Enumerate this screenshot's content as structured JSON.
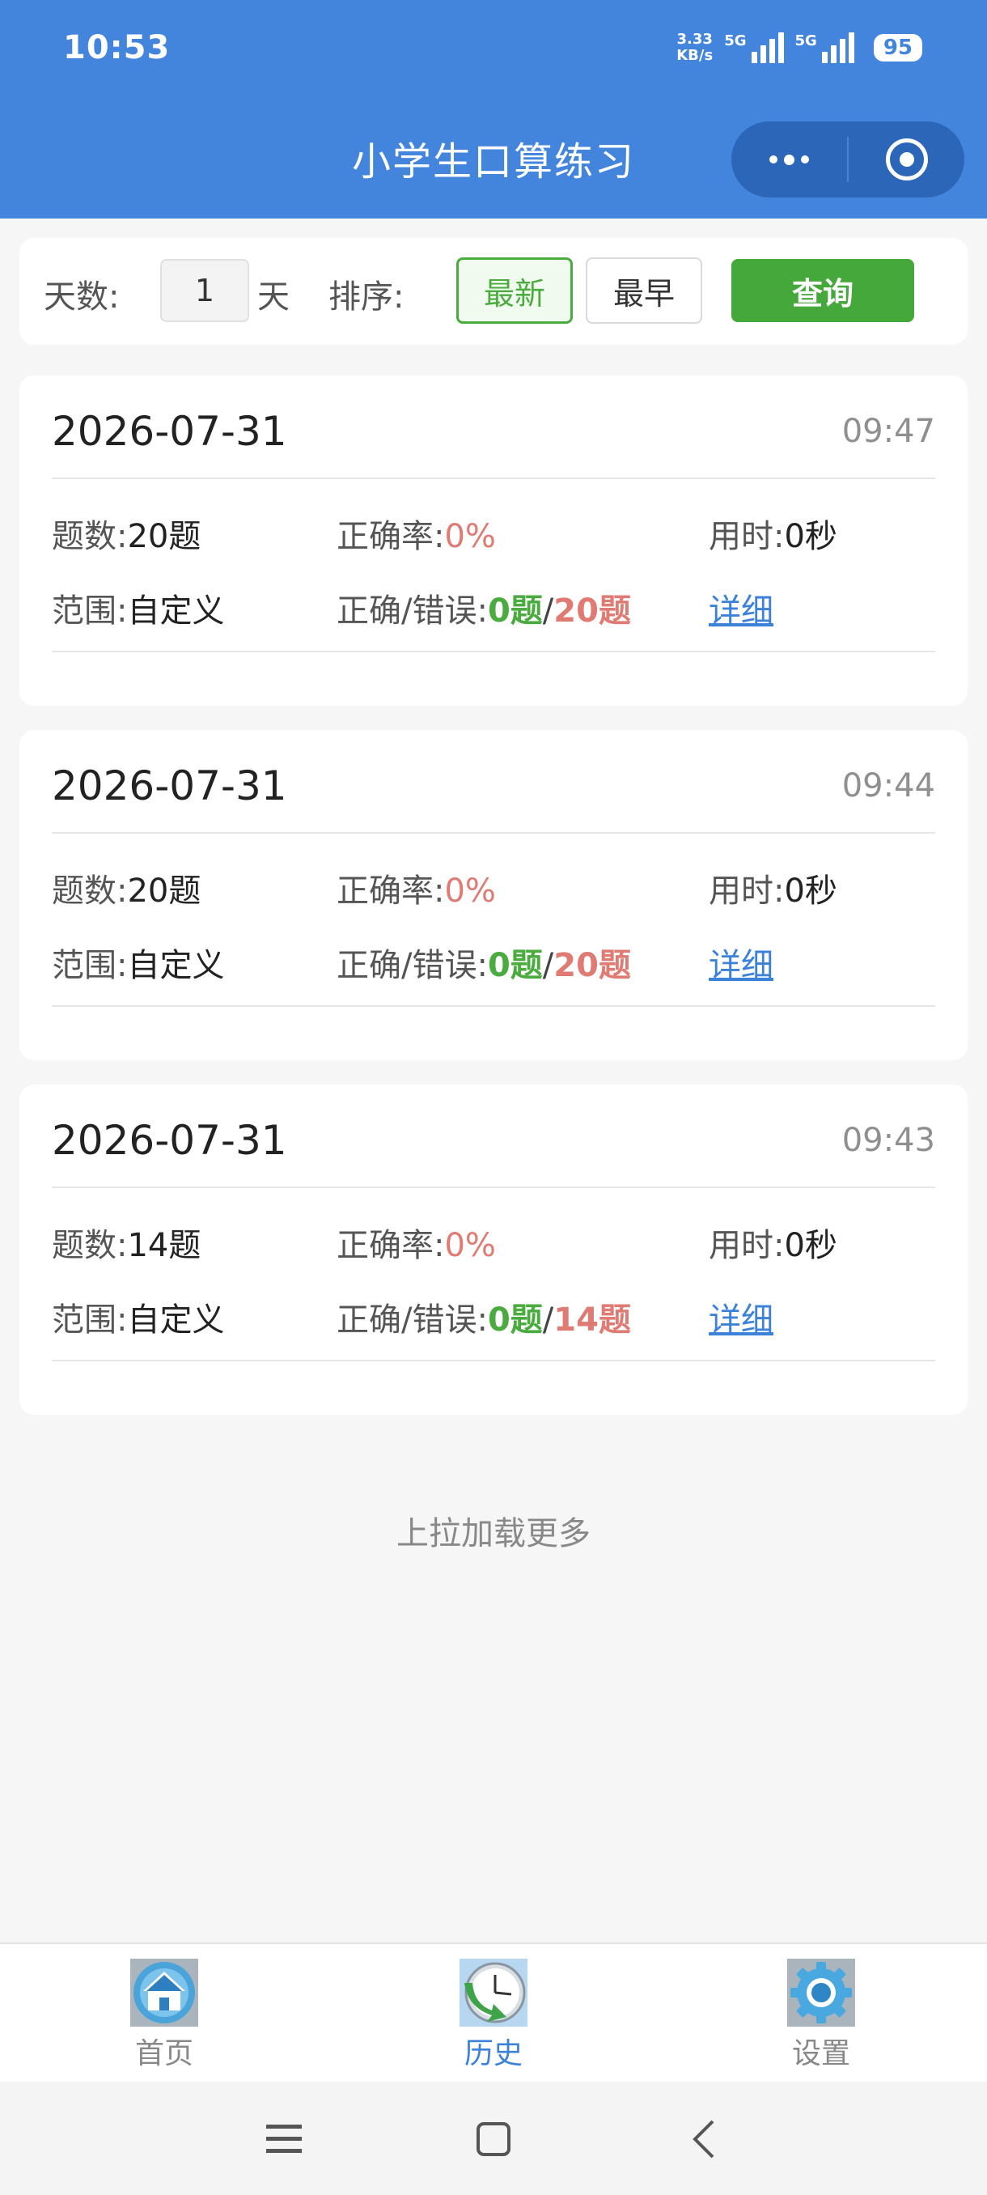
{
  "status_bar": {
    "time": "10:53",
    "net_speed_value": "3.33",
    "net_speed_unit": "KB/s",
    "sim1_label": "5G",
    "sim2_label": "5G",
    "battery": "95"
  },
  "header": {
    "title": "小学生口算练习"
  },
  "filter": {
    "days_label": "天数:",
    "days_value": "1",
    "days_unit": "天",
    "sort_label": "排序:",
    "sort_newest": "最新",
    "sort_oldest": "最早",
    "sort_selected": "最新",
    "query_button": "查询"
  },
  "labels": {
    "count": "题数:",
    "accuracy": "正确率:",
    "duration": "用时:",
    "scope": "范围:",
    "right_wrong": "正确/错误:",
    "slash": "/",
    "detail": "详细"
  },
  "records": [
    {
      "date": "2026-07-31",
      "time": "09:47",
      "count": "20题",
      "accuracy": "0%",
      "duration": "0秒",
      "scope": "自定义",
      "correct": "0题",
      "wrong": "20题"
    },
    {
      "date": "2026-07-31",
      "time": "09:44",
      "count": "20题",
      "accuracy": "0%",
      "duration": "0秒",
      "scope": "自定义",
      "correct": "0题",
      "wrong": "20题"
    },
    {
      "date": "2026-07-31",
      "time": "09:43",
      "count": "14题",
      "accuracy": "0%",
      "duration": "0秒",
      "scope": "自定义",
      "correct": "0题",
      "wrong": "14题"
    }
  ],
  "load_more": "上拉加载更多",
  "tabbar": {
    "items": [
      {
        "label": "首页",
        "icon": "home-icon"
      },
      {
        "label": "历史",
        "icon": "clock-icon"
      },
      {
        "label": "设置",
        "icon": "gear-icon"
      }
    ],
    "active": "历史"
  },
  "colors": {
    "header_bg": "#4384dc",
    "accent_green": "#45a83a",
    "error_red": "#e07b74",
    "link_blue": "#3b82d8"
  }
}
